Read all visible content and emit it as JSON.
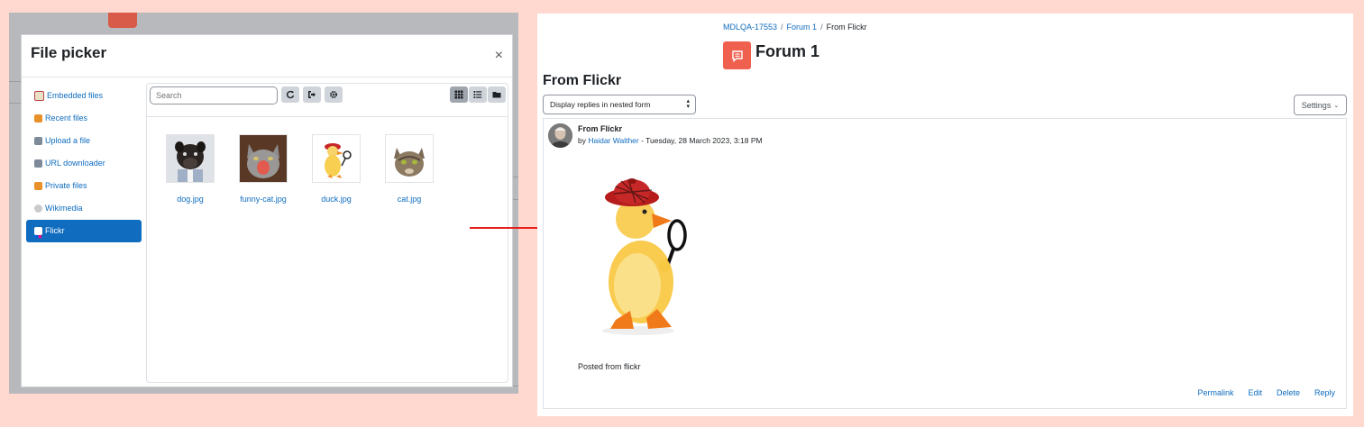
{
  "file_picker": {
    "title": "File picker",
    "close_glyph": "×",
    "repositories": [
      {
        "label": "Embedded files",
        "icon": "clipboard-icon"
      },
      {
        "label": "Recent files",
        "icon": "recent-files-icon"
      },
      {
        "label": "Upload a file",
        "icon": "upload-icon"
      },
      {
        "label": "URL downloader",
        "icon": "url-download-icon"
      },
      {
        "label": "Private files",
        "icon": "private-files-icon"
      },
      {
        "label": "Wikimedia",
        "icon": "wikimedia-icon"
      },
      {
        "label": "Flickr",
        "icon": "flickr-icon",
        "active": true
      }
    ],
    "search_placeholder": "Search",
    "files": [
      {
        "name": "dog.jpg"
      },
      {
        "name": "funny-cat.jpg"
      },
      {
        "name": "duck.jpg"
      },
      {
        "name": "cat.jpg"
      }
    ]
  },
  "forum": {
    "breadcrumb": [
      "MDLQA-17553",
      "Forum 1",
      "From Flickr"
    ],
    "title": "Forum 1",
    "discussion_title": "From Flickr",
    "display_mode": "Display replies in nested form",
    "settings_label": "Settings",
    "post": {
      "subject": "From Flickr",
      "by_prefix": "by",
      "author": "Haidar Walther",
      "date": " - Tuesday, 28 March 2023, 3:18 PM",
      "body": "Posted from flickr",
      "actions": [
        "Permalink",
        "Edit",
        "Delete",
        "Reply"
      ]
    }
  },
  "colors": {
    "link": "#0f6cbf",
    "forum_icon": "#f0604f",
    "arrow": "#e8201a",
    "background": "#ffd9cf"
  }
}
